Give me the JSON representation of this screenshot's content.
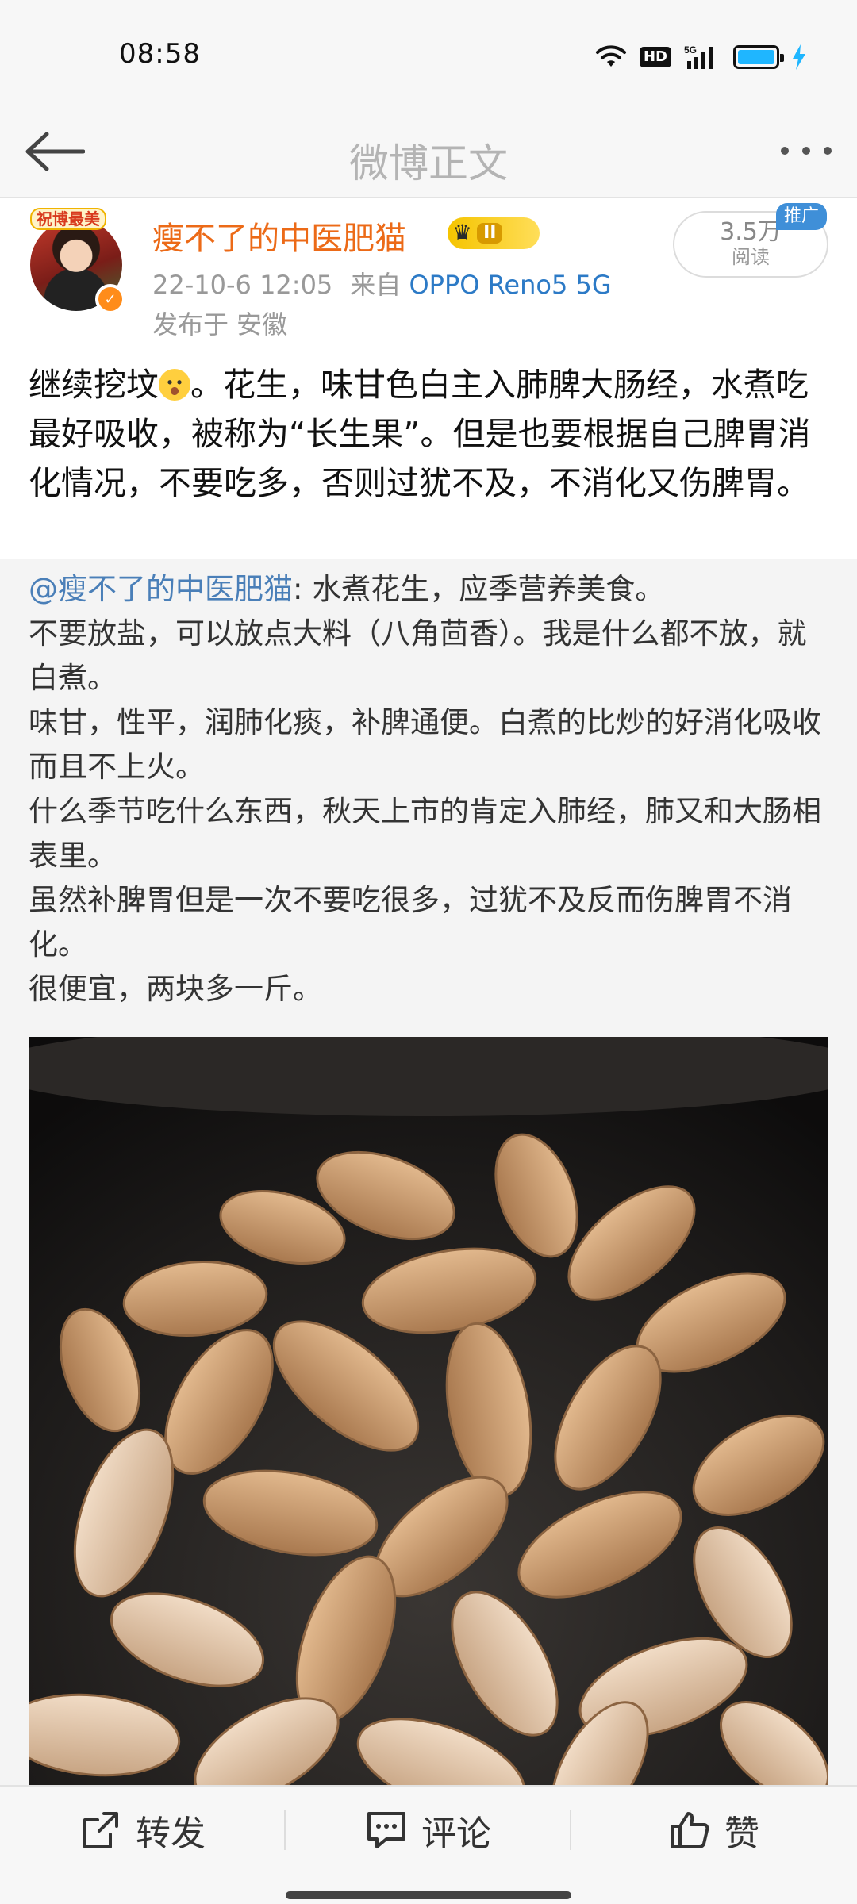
{
  "status_bar": {
    "time": "08:58",
    "hd_label": "HD",
    "network_label": "5G",
    "battery_level_percent": 100,
    "battery_color": "#1fb6ff"
  },
  "nav": {
    "title": "微博正文",
    "back_icon": "back-arrow-icon",
    "more_icon": "more-dots-icon"
  },
  "post": {
    "avatar_badge": "祝博最美",
    "username": "瘦不了的中医肥猫",
    "vip_level": "II",
    "date": "22-10-6 12:05",
    "source_prefix": "来自",
    "device": "OPPO Reno5 5G",
    "location": "发布于 安徽",
    "views_count": "3.5万",
    "views_label": "阅读",
    "promo_tag": "推广",
    "text_before_emoji": "继续挖坟",
    "text_after_emoji": "。花生，味甘色白主入肺脾大肠经，水煮吃最好吸收，被称为“长生果”。但是也要根据自己脾胃消化情况，不要吃多，否则过犹不及，不消化又伤脾胃。"
  },
  "repost": {
    "mention": "@瘦不了的中医肥猫",
    "lines": [
      ": 水煮花生，应季营养美食。",
      "不要放盐，可以放点大料（八角茴香）。我是什么都不放，就白煮。",
      "味甘，性平，润肺化痰，补脾通便。白煮的比炒的好消化吸收而且不上火。",
      "什么季节吃什么东西，秋天上市的肯定入肺经，肺又和大肠相表里。",
      "虽然补脾胃但是一次不要吃很多，过犹不及反而伤脾胃不消化。",
      "很便宜，两块多一斤。"
    ]
  },
  "bottom_bar": {
    "repost_label": "转发",
    "comment_label": "评论",
    "like_label": "赞"
  },
  "colors": {
    "username": "#ec6a17",
    "link": "#4a7fb8",
    "device": "#2c7ac6",
    "promo": "#3f8fd8"
  }
}
